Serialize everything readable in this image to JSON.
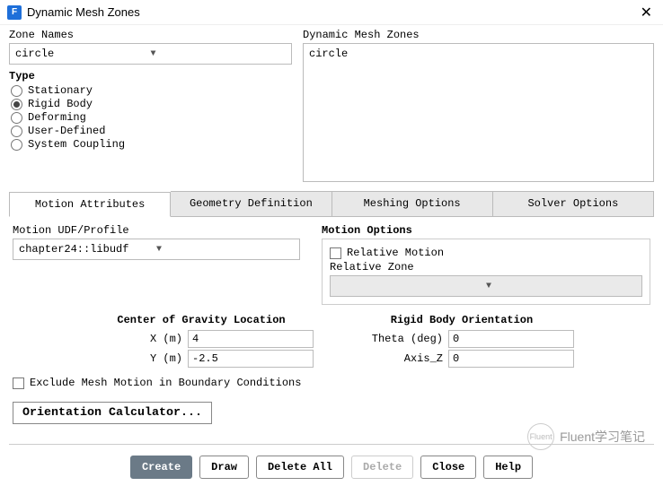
{
  "window": {
    "title": "Dynamic Mesh Zones",
    "icon_letter": "F"
  },
  "zone_names": {
    "label": "Zone Names",
    "value": "circle"
  },
  "dmz_list": {
    "label": "Dynamic Mesh Zones",
    "items": [
      "circle"
    ]
  },
  "type": {
    "label": "Type",
    "options": [
      "Stationary",
      "Rigid Body",
      "Deforming",
      "User-Defined",
      "System Coupling"
    ],
    "selected": "Rigid Body"
  },
  "tabs": {
    "items": [
      "Motion Attributes",
      "Geometry Definition",
      "Meshing Options",
      "Solver Options"
    ],
    "active": "Motion Attributes"
  },
  "motion_udf": {
    "label": "Motion UDF/Profile",
    "value": "chapter24::libudf"
  },
  "motion_options": {
    "label": "Motion Options",
    "relative_motion": "Relative Motion",
    "relative_zone": "Relative Zone"
  },
  "cog": {
    "label": "Center of Gravity Location",
    "x_label": "X (m)",
    "x_value": "4",
    "y_label": "Y (m)",
    "y_value": "-2.5"
  },
  "rbo": {
    "label": "Rigid Body Orientation",
    "theta_label": "Theta (deg)",
    "theta_value": "0",
    "axis_label": "Axis_Z",
    "axis_value": "0"
  },
  "exclude_label": "Exclude Mesh Motion in Boundary Conditions",
  "orient_calc": "Orientation Calculator...",
  "buttons": {
    "create": "Create",
    "draw": "Draw",
    "delete_all": "Delete All",
    "delete": "Delete",
    "close": "Close",
    "help": "Help"
  },
  "watermark": "Fluent学习笔记"
}
